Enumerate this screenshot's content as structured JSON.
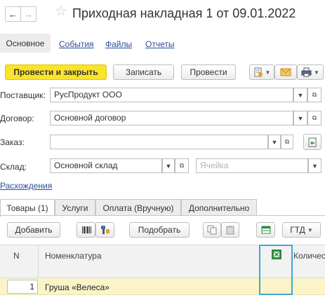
{
  "window": {
    "title": "Приходная накладная 1 от 09.01.2022"
  },
  "icons": [
    "back-arrow-icon",
    "forward-arrow-icon",
    "star-icon",
    "report-icon",
    "email-icon",
    "print-icon",
    "barcode-icon",
    "scanner-icon",
    "copy-icon",
    "paste-icon",
    "excel-icon",
    "open-icon",
    "add-doc-icon"
  ],
  "sections": {
    "main": "Основное",
    "events": "События",
    "files": "Файлы",
    "reports": "Отчеты"
  },
  "toolbar": {
    "post_close": "Провести и закрыть",
    "save": "Записать",
    "post": "Провести"
  },
  "form": {
    "supplier_label": "Поставщик:",
    "supplier_value": "РусПродукт ООО",
    "contract_label": "Договор:",
    "contract_value": "Основной договор",
    "order_label": "Заказ:",
    "order_value": "",
    "warehouse_label": "Склад:",
    "warehouse_value": "Основной склад",
    "cell_placeholder": "Ячейка",
    "discrepancies_link": "Расхождения"
  },
  "tabs": [
    "Товары (1)",
    "Услуги",
    "Оплата (Вручную)",
    "Дополнительно"
  ],
  "table_toolbar": {
    "add": "Добавить",
    "select": "Подобрать",
    "gtd": "ГТД"
  },
  "table": {
    "columns": [
      "N",
      "Номенклатура",
      "Количес"
    ],
    "rows": [
      {
        "n": "1",
        "item": "Груша «Велеса»"
      }
    ]
  },
  "colors": {
    "primary_button": "#fbe32b",
    "link": "#2b4e9a",
    "selected_row": "#fbf4c9",
    "highlight_frame": "#3ea7d7"
  }
}
